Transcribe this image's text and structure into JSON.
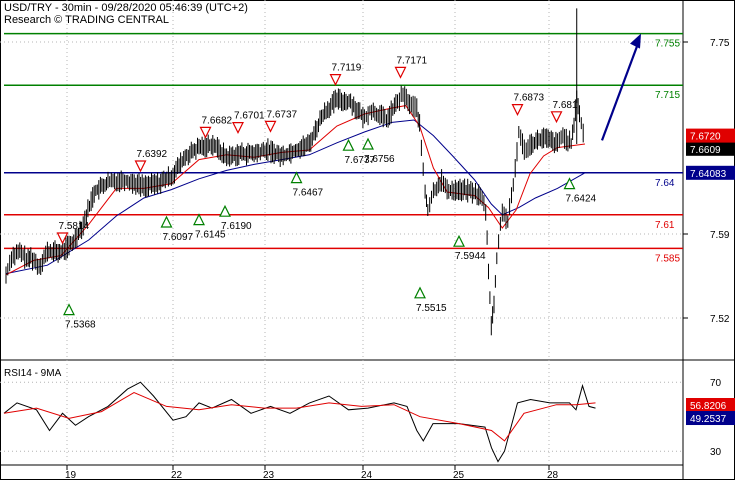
{
  "header": {
    "title": "USD/TRY - 30min - 09/28/2020 05:46:39 (UTC+2)",
    "source": "Research © TRADING CENTRAL"
  },
  "colors": {
    "resistance": "#008000",
    "pivot": "#00008b",
    "support": "#e00000",
    "candle": "#000000",
    "ma_slow": "#00008b",
    "ma_fast": "#e00000",
    "rsi": "#000000",
    "rsi_ma": "#e00000",
    "arrow": "#00008b",
    "last_price_bg": "#000000",
    "grid": "#b4b4b4"
  },
  "chart_data": [
    {
      "type": "line",
      "title": "USD/TRY - 30min - 09/28/2020 05:46:39 (UTC+2)",
      "ylim": [
        7.485,
        7.785
      ],
      "y_ticks": [
        7.52,
        7.59,
        7.75
      ],
      "x_ticks": [
        "19",
        "22",
        "23",
        "24",
        "25",
        "28"
      ],
      "grid": true,
      "price_path": [
        [
          0.0,
          7.556
        ],
        [
          0.02,
          7.571
        ],
        [
          0.05,
          7.575
        ],
        [
          0.08,
          7.568
        ],
        [
          0.09,
          7.571
        ],
        [
          0.12,
          7.563
        ],
        [
          0.15,
          7.575
        ],
        [
          0.2,
          7.575
        ],
        [
          0.24,
          7.582
        ],
        [
          0.28,
          7.598
        ],
        [
          0.32,
          7.625
        ],
        [
          0.37,
          7.633
        ],
        [
          0.43,
          7.635
        ],
        [
          0.5,
          7.63
        ],
        [
          0.55,
          7.632
        ],
        [
          0.6,
          7.638
        ],
        [
          0.65,
          7.654
        ],
        [
          0.7,
          7.662
        ],
        [
          0.75,
          7.665
        ],
        [
          0.8,
          7.654
        ],
        [
          0.85,
          7.657
        ],
        [
          0.9,
          7.657
        ],
        [
          0.95,
          7.66
        ],
        [
          1.0,
          7.655
        ],
        [
          1.05,
          7.66
        ],
        [
          1.1,
          7.665
        ],
        [
          1.15,
          7.69
        ],
        [
          1.2,
          7.702
        ],
        [
          1.25,
          7.7
        ],
        [
          1.3,
          7.686
        ],
        [
          1.32,
          7.693
        ],
        [
          1.35,
          7.69
        ],
        [
          1.38,
          7.685
        ],
        [
          1.42,
          7.7
        ],
        [
          1.44,
          7.706
        ],
        [
          1.47,
          7.697
        ],
        [
          1.49,
          7.695
        ],
        [
          1.5,
          7.68
        ],
        [
          1.52,
          7.625
        ],
        [
          1.53,
          7.61
        ],
        [
          1.55,
          7.625
        ],
        [
          1.58,
          7.635
        ],
        [
          1.6,
          7.626
        ],
        [
          1.63,
          7.627
        ],
        [
          1.68,
          7.626
        ],
        [
          1.72,
          7.622
        ],
        [
          1.74,
          7.61
        ],
        [
          1.75,
          7.56
        ],
        [
          1.76,
          7.515
        ],
        [
          1.77,
          7.53
        ],
        [
          1.78,
          7.57
        ],
        [
          1.8,
          7.61
        ],
        [
          1.82,
          7.6
        ],
        [
          1.84,
          7.63
        ],
        [
          1.86,
          7.675
        ],
        [
          1.88,
          7.66
        ],
        [
          1.9,
          7.665
        ],
        [
          1.95,
          7.67
        ],
        [
          2.0,
          7.665
        ],
        [
          2.02,
          7.672
        ],
        [
          2.05,
          7.665
        ],
        [
          2.06,
          7.68
        ],
        [
          2.07,
          7.705
        ],
        [
          2.08,
          7.69
        ],
        [
          2.1,
          7.665
        ]
      ],
      "wicks": [
        {
          "x": 2.07,
          "low": 7.665,
          "high": 7.778
        }
      ],
      "ma_fast": [
        [
          0.0,
          7.556
        ],
        [
          0.1,
          7.568
        ],
        [
          0.2,
          7.572
        ],
        [
          0.3,
          7.598
        ],
        [
          0.4,
          7.628
        ],
        [
          0.5,
          7.628
        ],
        [
          0.6,
          7.632
        ],
        [
          0.7,
          7.652
        ],
        [
          0.8,
          7.656
        ],
        [
          0.9,
          7.654
        ],
        [
          1.0,
          7.658
        ],
        [
          1.1,
          7.66
        ],
        [
          1.2,
          7.68
        ],
        [
          1.3,
          7.69
        ],
        [
          1.4,
          7.695
        ],
        [
          1.45,
          7.697
        ],
        [
          1.5,
          7.68
        ],
        [
          1.55,
          7.645
        ],
        [
          1.6,
          7.625
        ],
        [
          1.7,
          7.622
        ],
        [
          1.75,
          7.612
        ],
        [
          1.8,
          7.595
        ],
        [
          1.85,
          7.61
        ],
        [
          1.9,
          7.64
        ],
        [
          1.95,
          7.655
        ],
        [
          2.0,
          7.662
        ],
        [
          2.1,
          7.665
        ]
      ],
      "ma_slow": [
        [
          0.0,
          7.557
        ],
        [
          0.15,
          7.564
        ],
        [
          0.3,
          7.585
        ],
        [
          0.4,
          7.605
        ],
        [
          0.5,
          7.62
        ],
        [
          0.6,
          7.627
        ],
        [
          0.7,
          7.636
        ],
        [
          0.8,
          7.643
        ],
        [
          0.9,
          7.648
        ],
        [
          1.0,
          7.652
        ],
        [
          1.1,
          7.656
        ],
        [
          1.2,
          7.666
        ],
        [
          1.3,
          7.675
        ],
        [
          1.4,
          7.683
        ],
        [
          1.48,
          7.685
        ],
        [
          1.55,
          7.672
        ],
        [
          1.62,
          7.655
        ],
        [
          1.7,
          7.635
        ],
        [
          1.76,
          7.615
        ],
        [
          1.8,
          7.606
        ],
        [
          1.86,
          7.612
        ],
        [
          1.92,
          7.62
        ],
        [
          2.0,
          7.628
        ],
        [
          2.1,
          7.641
        ]
      ],
      "levels": [
        {
          "label": "7.755",
          "value": 7.757,
          "kind": "resistance"
        },
        {
          "label": "7.715",
          "value": 7.714,
          "kind": "resistance"
        },
        {
          "label": "7.64",
          "value": 7.641,
          "kind": "pivot"
        },
        {
          "label": "7.61",
          "value": 7.606,
          "kind": "support"
        },
        {
          "label": "7.585",
          "value": 7.578,
          "kind": "support"
        }
      ],
      "price_tags": [
        {
          "label": "7.6609",
          "value": 7.661,
          "style": "dark"
        },
        {
          "label": "7.64083",
          "value": 7.641,
          "style": "blue"
        },
        {
          "label": "7.6720",
          "value": 7.672,
          "style": "red"
        }
      ],
      "highs": [
        {
          "label": "7.5814",
          "x": 0.09,
          "y": 7.58
        },
        {
          "label": "7.6392",
          "x": 0.21,
          "y": 7.64
        },
        {
          "label": "7.6682",
          "x": 0.31,
          "y": 7.668
        },
        {
          "label": "7.6701",
          "x": 0.36,
          "y": 7.672
        },
        {
          "label": "7.6737",
          "x": 0.41,
          "y": 7.673
        },
        {
          "label": "7.7119",
          "x": 0.51,
          "y": 7.712
        },
        {
          "label": "7.7171",
          "x": 0.61,
          "y": 7.718
        },
        {
          "label": "7.6873",
          "x": 0.79,
          "y": 7.687
        },
        {
          "label": "7.681",
          "x": 0.85,
          "y": 7.681
        }
      ],
      "lows": [
        {
          "label": "7.5368",
          "x": 0.1,
          "y": 7.537
        },
        {
          "label": "7.6097",
          "x": 0.25,
          "y": 7.61
        },
        {
          "label": "7.6145",
          "x": 0.3,
          "y": 7.612
        },
        {
          "label": "7.6190",
          "x": 0.34,
          "y": 7.619
        },
        {
          "label": "7.6467",
          "x": 0.45,
          "y": 7.647
        },
        {
          "label": "7.6737",
          "x": 0.53,
          "y": 7.674
        },
        {
          "label": "7.6756",
          "x": 0.56,
          "y": 7.675
        },
        {
          "label": "7.5515",
          "x": 0.64,
          "y": 7.551
        },
        {
          "label": "7.5944",
          "x": 0.7,
          "y": 7.594
        },
        {
          "label": "7.6424",
          "x": 0.87,
          "y": 7.642
        }
      ],
      "arrow": {
        "from": [
          0.92,
          7.668
        ],
        "to": [
          0.98,
          7.757
        ]
      }
    },
    {
      "type": "line",
      "title": "RSI14 - 9MA",
      "ylim": [
        22,
        80
      ],
      "y_ticks": [
        30,
        70
      ],
      "series": [
        {
          "name": "RSI14",
          "points": [
            [
              0.0,
              52
            ],
            [
              0.02,
              58
            ],
            [
              0.05,
              54
            ],
            [
              0.07,
              42
            ],
            [
              0.09,
              52
            ],
            [
              0.11,
              45
            ],
            [
              0.13,
              50
            ],
            [
              0.16,
              56
            ],
            [
              0.19,
              66
            ],
            [
              0.21,
              70
            ],
            [
              0.23,
              62
            ],
            [
              0.26,
              48
            ],
            [
              0.28,
              50
            ],
            [
              0.3,
              58
            ],
            [
              0.32,
              55
            ],
            [
              0.35,
              60
            ],
            [
              0.38,
              52
            ],
            [
              0.41,
              56
            ],
            [
              0.44,
              52
            ],
            [
              0.47,
              58
            ],
            [
              0.5,
              62
            ],
            [
              0.53,
              54
            ],
            [
              0.56,
              55
            ],
            [
              0.6,
              58
            ],
            [
              0.62,
              56
            ],
            [
              0.635,
              42
            ],
            [
              0.645,
              36
            ],
            [
              0.66,
              46
            ],
            [
              0.7,
              46
            ],
            [
              0.74,
              44
            ],
            [
              0.75,
              32
            ],
            [
              0.76,
              24
            ],
            [
              0.77,
              30
            ],
            [
              0.78,
              44
            ],
            [
              0.79,
              58
            ],
            [
              0.81,
              60
            ],
            [
              0.84,
              58
            ],
            [
              0.87,
              58
            ],
            [
              0.88,
              54
            ],
            [
              0.89,
              68
            ],
            [
              0.9,
              56
            ],
            [
              0.91,
              55
            ]
          ]
        },
        {
          "name": "9MA",
          "points": [
            [
              0.0,
              52
            ],
            [
              0.05,
              55
            ],
            [
              0.1,
              49
            ],
            [
              0.15,
              53
            ],
            [
              0.2,
              64
            ],
            [
              0.25,
              56
            ],
            [
              0.3,
              54
            ],
            [
              0.35,
              57
            ],
            [
              0.4,
              55
            ],
            [
              0.45,
              55
            ],
            [
              0.5,
              58
            ],
            [
              0.55,
              56
            ],
            [
              0.6,
              57
            ],
            [
              0.64,
              50
            ],
            [
              0.7,
              46
            ],
            [
              0.75,
              42
            ],
            [
              0.77,
              36
            ],
            [
              0.8,
              52
            ],
            [
              0.85,
              57
            ],
            [
              0.88,
              57
            ],
            [
              0.91,
              58
            ]
          ]
        }
      ],
      "price_tags": [
        {
          "label": "56.8206",
          "value": 56.8,
          "style": "red"
        },
        {
          "label": "49.2537",
          "value": 49.25,
          "style": "blue"
        }
      ]
    }
  ]
}
